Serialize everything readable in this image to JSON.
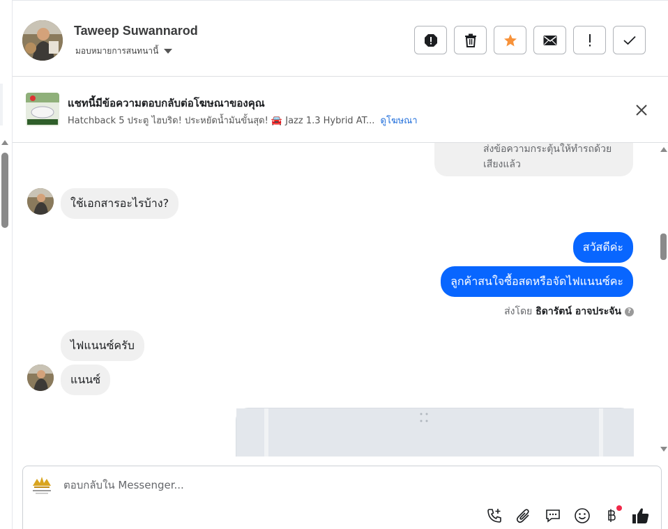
{
  "header": {
    "contact_name": "Taweep Suwannarod",
    "assign_label": "มอบหมายการสนทนานี้",
    "actions": [
      {
        "name": "spam-button",
        "icon": "alert-octagon-icon"
      },
      {
        "name": "delete-button",
        "icon": "trash-icon"
      },
      {
        "name": "star-button",
        "icon": "star-icon",
        "color": "#f7923a"
      },
      {
        "name": "mark-unread-button",
        "icon": "envelope-icon"
      },
      {
        "name": "follow-up-button",
        "icon": "exclamation-icon"
      },
      {
        "name": "mark-done-button",
        "icon": "check-icon"
      }
    ]
  },
  "ad_banner": {
    "title": "แชทนี้มีข้อความตอบกลับต่อโฆษณาของคุณ",
    "subtitle": "Hatchback 5 ประตู ไฮบริด! ประหยัดน้ำมันขั้นสุด! 🚘 Jazz 1.3 Hybrid AT...",
    "link_label": "ดูโฆษณา"
  },
  "messages": {
    "partial_top": "ส่งข้อความกระตุ้นให้ทำรถด้วยเสียงแล้ว",
    "partial_line1": "ส่งข้อความกระตุ้นให้ทำรถด้วย",
    "partial_line2": "เสียงแล้ว",
    "incoming_1": "ใช้เอกสารอะไรบ้าง?",
    "outgoing_1": "สวัสดีค่ะ",
    "outgoing_2": "ลูกค้าสนใจซื้อสดหรือจัดไฟแนนซ์คะ",
    "sent_by_prefix": "ส่งโดย",
    "sent_by_name": "ธิดารัตน์ อาจประจัน",
    "incoming_2": "ไฟแนนซ์ครับ",
    "incoming_3": "แนนซ์"
  },
  "composer": {
    "placeholder": "ตอบกลับใน Messenger...",
    "tools": [
      "phone-add-icon",
      "paperclip-icon",
      "saved-reply-icon",
      "emoji-icon",
      "baht-icon",
      "thumbs-up-icon"
    ]
  },
  "colors": {
    "outgoing_bubble": "#0866ff",
    "incoming_bubble": "#f0f0f0",
    "link": "#216fdb",
    "star": "#f7923a"
  }
}
